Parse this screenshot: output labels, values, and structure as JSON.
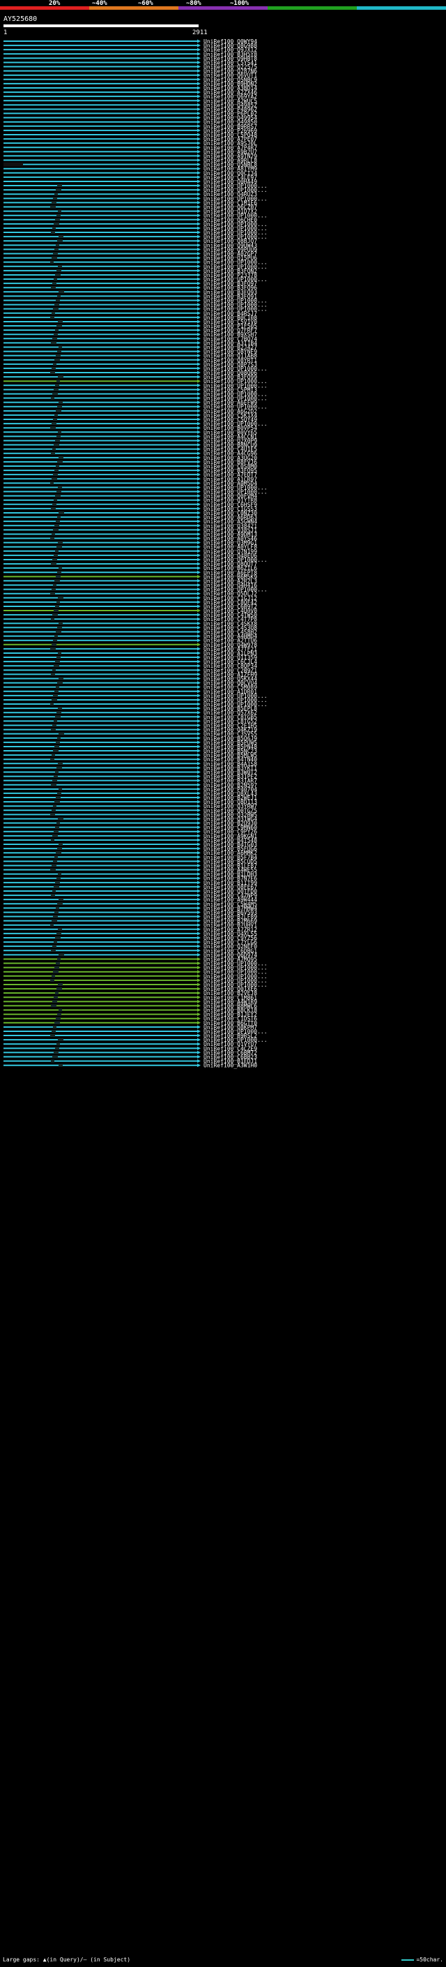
{
  "scale": {
    "ticks": [
      "20%",
      "~40%",
      "~60%",
      "~80%",
      "~100%"
    ],
    "colors": [
      "#e02020",
      "#e07820",
      "#8830b0",
      "#20a020",
      "#20b8c8"
    ]
  },
  "query": {
    "id": "AY525680",
    "start": "1",
    "end": "2911"
  },
  "hits": [
    "UniRef100_Q0WY94",
    "UniRef100_Q8G988",
    "UniRef100_Q9JX12",
    "UniRef100_B3H5Y8",
    "UniRef100_Q9HBT8",
    "UniRef100_C5YS41",
    "UniRef100_Q22575",
    "UniRef100_Q287N6",
    "UniRef100_Q6VUT1",
    "UniRef100_Q5NBC9",
    "UniRef100_B9HDN2",
    "UniRef100_A3BD14",
    "UniRef100_A2ZX46",
    "UniRef100_Q69YA2",
    "UniRef100_A2WUC5",
    "UniRef100_Q4985Z",
    "UniRef100_P48962",
    "UniRef100_P6PL02",
    "UniRef100_Q49954",
    "UniRef100_Q49850",
    "UniRef100_B9RRS7",
    "UniRef100_P26969",
    "UniRef100_C5PQ48",
    "UniRef100_A7PE07",
    "UniRef100_A9SJ0L",
    "UniRef100_A7P4R7",
    "UniRef100_A9B2U7",
    "UniRef100_A9TN29",
    "UniRef100_A9RLL8",
    "UniRef100_Q5NBC8",
    "UniRef100_A8IYM9",
    "UniRef100_Q0CI34",
    "UniRef100_C4LE97",
    "UniRef100_Q0HA49",
    "UniRef100_UP1000...",
    "UniRef100_UP1000...",
    "UniRef100_Q4RUZ3",
    "UniRef100_UP1000...",
    "UniRef100_C1M1E6",
    "UniRef100_Q6CZ07",
    "UniRef100_Q1D7X2",
    "UniRef100_UP1000...",
    "UniRef100_Q6CHE0",
    "UniRef100_UP1000...",
    "UniRef100_UP1000...",
    "UniRef100_UP1000...",
    "UniRef100_UP1000...",
    "UniRef100_Q8BJQ7",
    "UniRef100_Q9UW43",
    "UniRef100_Q9PUU9",
    "UniRef100_A0ZGP7",
    "UniRef100_Q15PU6",
    "UniRef100_UP1000...",
    "UniRef100_UP1000...",
    "UniRef100_B3FQN2",
    "UniRef100_P23378",
    "UniRef100_UP1000...",
    "UniRef100_B3FQ97",
    "UniRef100_B3FQ96",
    "UniRef100_B3FQ93",
    "UniRef100_B3FQ91",
    "UniRef100_UP1000...",
    "UniRef100_UP1000...",
    "UniRef100_UP1000...",
    "UniRef100_B4RSJ7",
    "UniRef100_B0C108",
    "UniRef100_C5V1V0",
    "UniRef100_P1F505",
    "UniRef100_Q7FRF7",
    "UniRef100_B9XSH7",
    "UniRef100_C7BQ74",
    "UniRef100_A3I1B4",
    "UniRef100_B2J427",
    "UniRef100_Q8YNF9",
    "UniRef100_Q11AB8",
    "UniRef100_Q8YRT1",
    "UniRef100_Q8P7S3",
    "UniRef100_UP1000...",
    "UniRef100_Q08Q06",
    "UniRef100_B3FQ99",
    "UniRef100_UP1000...",
    "UniRef100_UP1000...",
    "UniRef100_C5PMI3",
    "UniRef100_UP1000...",
    "UniRef100_UP1000...",
    "UniRef100_A6EFW9",
    "UniRef100_UP1000...",
    "UniRef100_A6G2D2",
    "UniRef100_C5K1X4",
    "UniRef100_C5QY49",
    "UniRef100_UP1000...",
    "UniRef100_B0VP54",
    "UniRef100_B0VY65",
    "UniRef100_A4CCN1",
    "UniRef100_Q2X0P9",
    "UniRef100_B8NCU9",
    "UniRef100_C4U1E5",
    "UniRef100_A4CG96",
    "UniRef100_A3UG20",
    "UniRef100_B8FVJ6",
    "UniRef100_C0S8M0",
    "UniRef100_B3FQ95",
    "UniRef100_A7EDT7",
    "UniRef100_A1CR97",
    "UniRef100_A0M5D4",
    "UniRef100_UP1000...",
    "UniRef100_UP1000...",
    "UniRef100_Q0FVM4",
    "UniRef100_Q1YTR8",
    "UniRef100_C6HSF9",
    "UniRef100_C1GSS3",
    "UniRef100_C0NZ30",
    "UniRef100_A6RD63",
    "UniRef100_A5GWN4",
    "UniRef100_Q38421",
    "UniRef100_Q38SJ1",
    "UniRef100_A9DM13",
    "UniRef100_A0YS46",
    "UniRef100_Q3M9G1",
    "UniRef100_A0YLF8",
    "UniRef100_Q7N199",
    "UniRef100_Q48EU6",
    "UniRef100_UP1000...",
    "UniRef100_Q8QUT7",
    "UniRef100_B6ZIL6",
    "UniRef100_A6EPT8",
    "UniRef100_B6M5K9",
    "UniRef100_A2R2L3",
    "UniRef100_Q4H416",
    "UniRef100_UP1000...",
    "UniRef100_Q5DLJ2",
    "UniRef100_C1GJ12",
    "UniRef100_C8QF42",
    "UniRef100_C6B9T2",
    "UniRef100_C4U0V0",
    "UniRef100_C4TWS0",
    "UniRef100_C4T7P8",
    "UniRef100_C4SKX8",
    "UniRef100_C4S3Q8",
    "UniRef100_C4S8H2",
    "UniRef100_A4HMD4",
    "UniRef100_A2TTU6",
    "UniRef100_Q4W978",
    "UniRef100_A7TF21",
    "UniRef100_A1LPN3",
    "UniRef100_Q1I359",
    "UniRef100_C6CJL4",
    "UniRef100_C8QP34",
    "UniRef100_C2B9Z1",
    "UniRef100_A1ZFH9",
    "UniRef100_Q5KX44",
    "UniRef100_Q0CVU4",
    "UniRef100_C5M089",
    "UniRef100_A1DR01",
    "UniRef100_UP1000...",
    "UniRef100_UP1000...",
    "UniRef100_UP1000...",
    "UniRef100_B5EPL8",
    "UniRef100_Q57X62",
    "UniRef100_C8TGB5",
    "UniRef100_C8TG52",
    "UniRef100_C2E1H5",
    "UniRef100_Q4KZ19",
    "UniRef100_C3SVS5",
    "UniRef100_B5Q6J9",
    "UniRef100_B5PUW5",
    "UniRef100_B5PN48",
    "UniRef100_B5NC23",
    "UniRef100_B5MLW5",
    "UniRef100_B4TN40",
    "UniRef100_B4A1S8",
    "UniRef100_B3YKT1",
    "UniRef100_B3W0T2",
    "UniRef100_B31PF2",
    "UniRef100_B31AR7",
    "UniRef100_B2N597",
    "UniRef100_P40704",
    "UniRef100_Q8XL43",
    "UniRef100_B2WEJ1",
    "UniRef100_Q8D113",
    "UniRef100_Q3YRW7",
    "UniRef100_Q0TGZ5",
    "UniRef100_Q32BW5",
    "UniRef100_Q31WG4",
    "UniRef100_B2U930",
    "UniRef100_C9MN60",
    "UniRef100_C9PY26",
    "UniRef100_A9KGN1",
    "UniRef100_B4T548",
    "UniRef100_B4TG03",
    "UniRef100_B5FUG6",
    "UniRef100_A6MMK2",
    "UniRef100_B5F7B4",
    "UniRef100_B5CUD5",
    "UniRef100_B1LF87",
    "UniRef100_A4WE55",
    "UniRef100_B1LDH3",
    "UniRef100_B7N7E6",
    "UniRef100_B1IT99",
    "UniRef100_Q8FE67",
    "UniRef100_Q0TFD0",
    "UniRef100_C4ZNP9",
    "UniRef100_A9W444",
    "UniRef100_C5W4M5",
    "UniRef100_B7MMW4",
    "UniRef100_B6V593",
    "UniRef100_B7LF89",
    "UniRef100_B7M669",
    "UniRef100_B7UHV1",
    "UniRef100_A7ZR12",
    "UniRef100_Q4XLS5",
    "UniRef100_C9YZ56",
    "UniRef100_C7YLG6",
    "UniRef100_Q2NEF0",
    "UniRef100_C6DBG1",
    "UniRef100_Q6D974",
    "UniRef100_A7MQ95",
    "UniRef100_UP1000...",
    "UniRef100_UP1000...",
    "UniRef100_UP1000...",
    "UniRef100_UP1000...",
    "UniRef100_UP1000...",
    "UniRef100_UP1000...",
    "UniRef100_Q01XE6",
    "UniRef100_B2VEJ8",
    "UniRef100_C1M861",
    "UniRef100_A4W1R9",
    "UniRef100_B8MWC6",
    "UniRef100_B8CK18",
    "UniRef100_B1JEY2",
    "UniRef100_C1DST6",
    "UniRef100_B6GTT0",
    "UniRef100_Q8KPM7",
    "UniRef100_UP1000...",
    "UniRef100_B9RSL2",
    "UniRef100_UP1000...",
    "UniRef100_Q1VYU7",
    "UniRef100_C4CZE9",
    "UniRef100_C6BM72",
    "UniRef100_C6BB23",
    "UniRef100_B1EDJ1",
    "UniRef100_A3W1H0"
  ],
  "legend": {
    "large_gaps": "Large gaps: ▲(in Query)/— (in Subject)",
    "scale_note": "=50char."
  }
}
